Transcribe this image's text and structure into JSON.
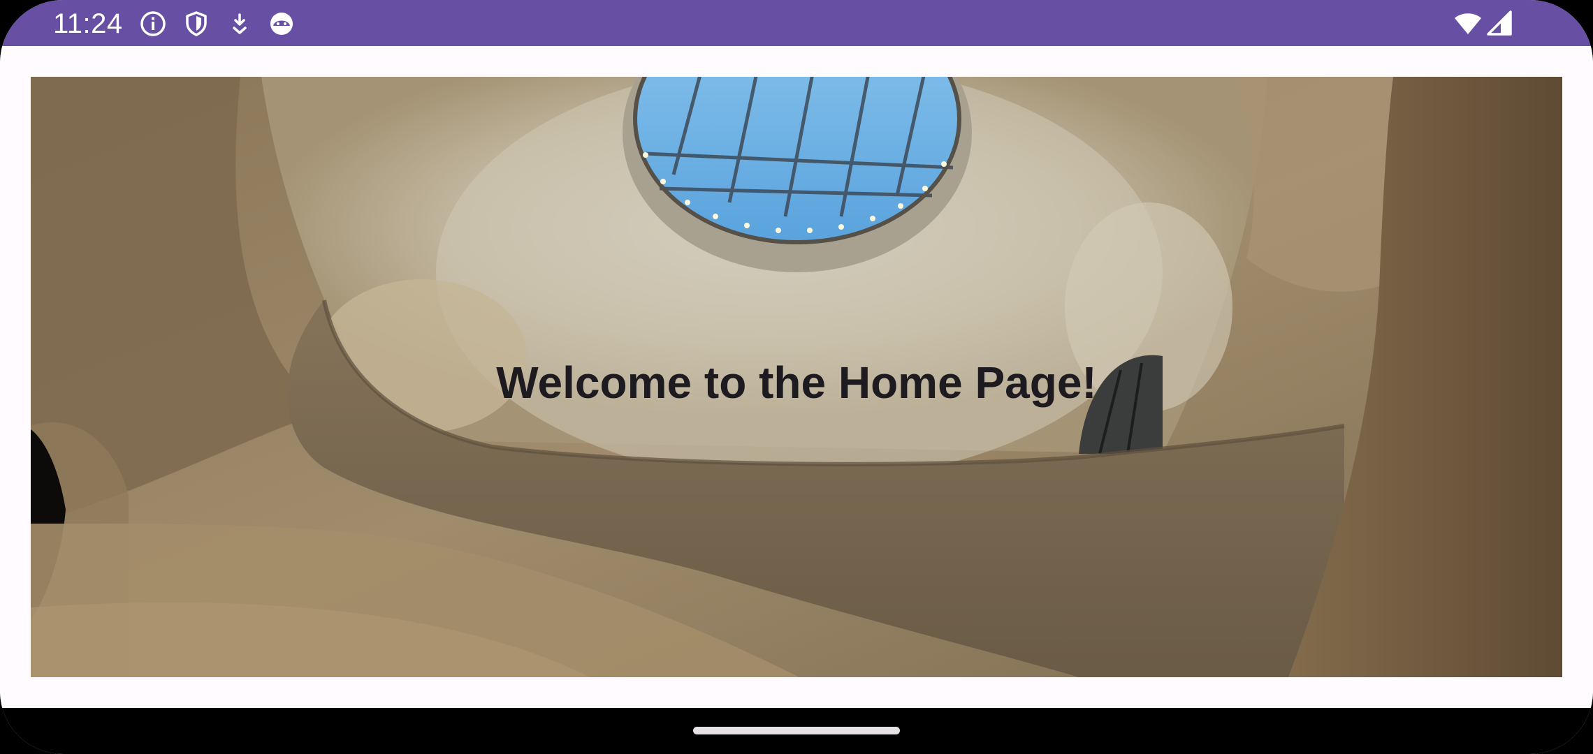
{
  "status_bar": {
    "time": "11:24",
    "background_color": "#6750a4",
    "left_icons": [
      "info-icon",
      "shield-icon",
      "download-icon",
      "android-face-icon"
    ],
    "right_icons": [
      "wifi-icon",
      "cellular-signal-icon"
    ]
  },
  "main": {
    "welcome_text": "Welcome to the Home Page!",
    "background_image": "museum-atrium-skylight-photo"
  },
  "nav_bar": {
    "handle": "home-gesture-handle"
  }
}
